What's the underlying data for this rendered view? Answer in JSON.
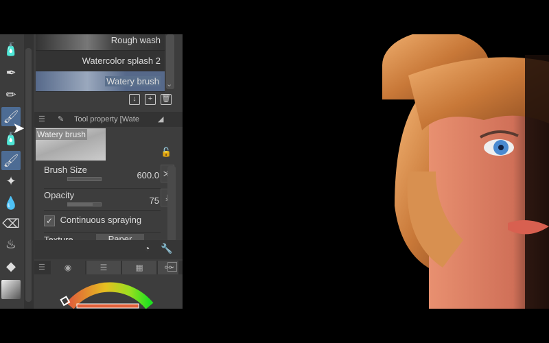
{
  "brush_list": {
    "items": [
      {
        "label": "Rough wash"
      },
      {
        "label": "Watercolor splash 2"
      },
      {
        "label": "Watery brush",
        "selected": true
      }
    ]
  },
  "tool_property": {
    "title": "Tool property [Wate",
    "brush_name": "Watery brush",
    "brush_size": {
      "label": "Brush Size",
      "value": "600.0"
    },
    "opacity": {
      "label": "Opacity",
      "value": "75"
    },
    "continuous_spraying": {
      "label": "Continuous spraying",
      "checked": true
    },
    "texture": {
      "label": "Texture",
      "value": "Paper"
    }
  },
  "colors": {
    "accent": "#4d6c94",
    "panel": "#3d3d3d",
    "selected_color": "#e0603a"
  }
}
